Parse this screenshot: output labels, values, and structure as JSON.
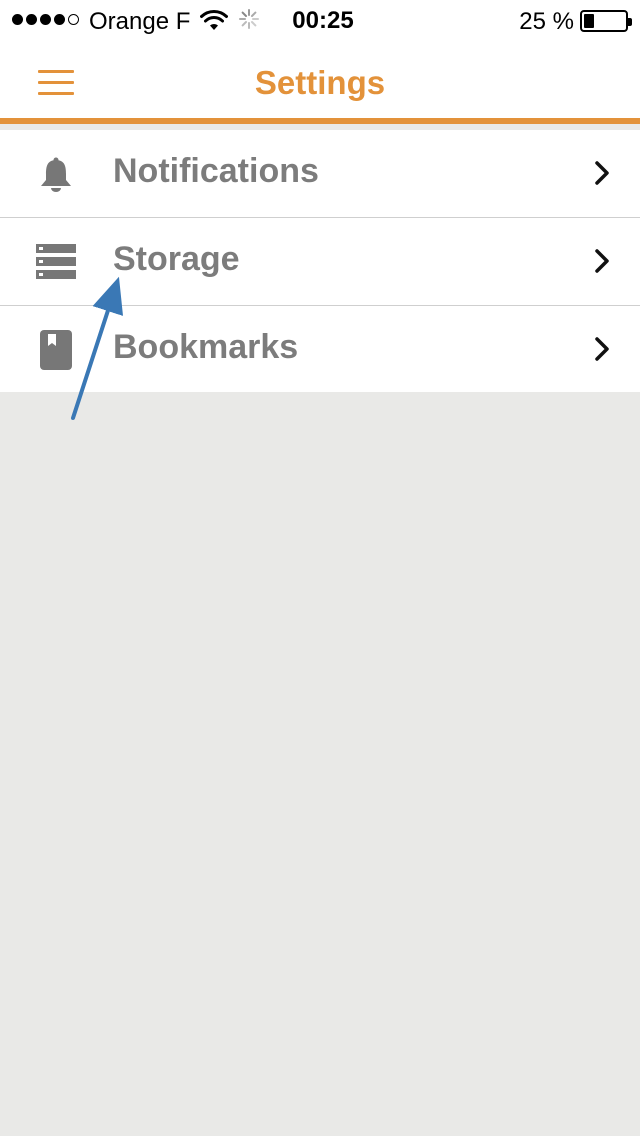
{
  "status_bar": {
    "carrier": "Orange F",
    "time": "00:25",
    "battery_percent": "25 %",
    "battery_level": 0.25,
    "signal_bars_filled": 4,
    "signal_bars_total": 5
  },
  "nav": {
    "title": "Settings",
    "menu_icon": "hamburger-menu-icon"
  },
  "settings": {
    "items": [
      {
        "label": "Notifications",
        "icon": "bell-icon"
      },
      {
        "label": "Storage",
        "icon": "server-storage-icon"
      },
      {
        "label": "Bookmarks",
        "icon": "bookmark-book-icon"
      }
    ]
  },
  "colors": {
    "accent": "#e3923a",
    "label_gray": "#7c7c7c",
    "icon_gray": "#777777",
    "background": "#e9e9e7",
    "annotation_arrow": "#3a78b5"
  }
}
